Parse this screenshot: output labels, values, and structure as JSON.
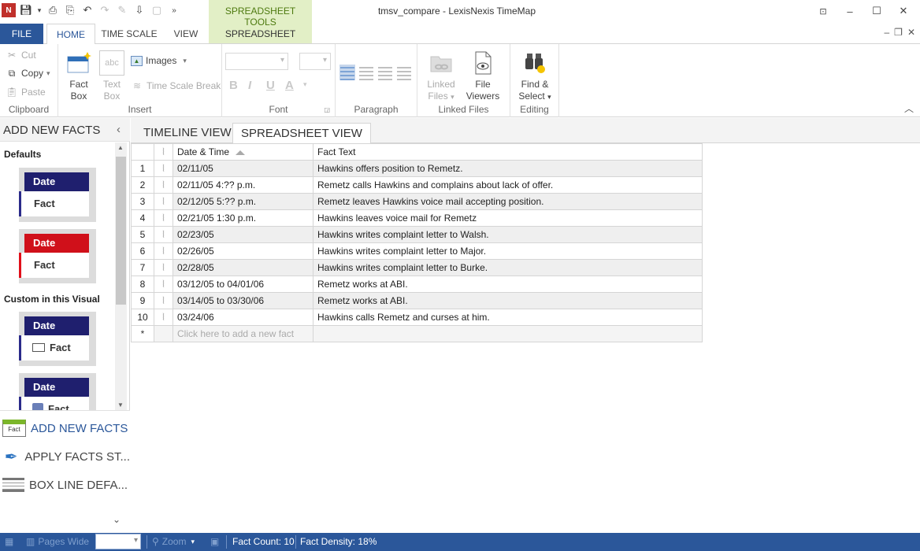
{
  "window": {
    "title": "tmsv_compare - LexisNexis TimeMap",
    "contextual_group": "SPREADSHEET TOOLS",
    "app_logo": "N"
  },
  "ribbon": {
    "tabs": {
      "file": "FILE",
      "home": "HOME",
      "time_scale": "TIME SCALE",
      "view": "VIEW",
      "spreadsheet": "SPREADSHEET"
    },
    "clipboard": {
      "label": "Clipboard",
      "cut": "Cut",
      "copy": "Copy",
      "paste": "Paste"
    },
    "insert": {
      "label": "Insert",
      "fact_box_line1": "Fact",
      "fact_box_line2": "Box",
      "text_box_line1": "Text",
      "text_box_line2": "Box",
      "text_box_icon_text": "abc",
      "images": "Images",
      "time_scale_break": "Time Scale Break"
    },
    "font": {
      "label": "Font",
      "bold": "B",
      "italic": "I",
      "underline": "U",
      "font_color": "A"
    },
    "paragraph": {
      "label": "Paragraph"
    },
    "linked_files": {
      "label": "Linked Files",
      "linked_files_line1": "Linked",
      "linked_files_line2": "Files",
      "file_viewers_line1": "File",
      "file_viewers_line2": "Viewers"
    },
    "editing": {
      "label": "Editing",
      "find_select_line1": "Find &",
      "find_select_line2": "Select"
    }
  },
  "left_pane": {
    "title": "ADD NEW FACTS",
    "defaults_label": "Defaults",
    "custom_label": "Custom in this Visual",
    "samples": [
      {
        "date": "Date",
        "fact": "Fact",
        "date_color": "#1f1f6e",
        "accent": "#2b2b8a"
      },
      {
        "date": "Date",
        "fact": "Fact",
        "date_color": "#d0101a",
        "accent": "#e0101a"
      },
      {
        "date": "Date",
        "fact": "Fact",
        "date_color": "#1f1f6e",
        "accent": "#2b2b8a"
      },
      {
        "date": "Date",
        "fact": "Fact",
        "date_color": "#1f1f6e",
        "accent": "#2b2b8a"
      }
    ],
    "nav": {
      "add_new_facts": "ADD NEW FACTS",
      "add_new_facts_icon_text": "Fact",
      "apply_facts": "APPLY FACTS ST...",
      "box_line": "BOX LINE DEFA..."
    }
  },
  "content": {
    "tabs": {
      "timeline": "TIMELINE VIEW",
      "spreadsheet": "SPREADSHEET VIEW"
    },
    "columns": {
      "date": "Date & Time",
      "fact": "Fact Text"
    },
    "rows": [
      {
        "n": "1",
        "date": "02/11/05",
        "fact": "Hawkins offers position to Remetz."
      },
      {
        "n": "2",
        "date": "02/11/05 4:?? p.m.",
        "fact": "Remetz calls Hawkins and complains about lack of offer."
      },
      {
        "n": "3",
        "date": "02/12/05 5:?? p.m.",
        "fact": "Remetz leaves Hawkins voice mail accepting position."
      },
      {
        "n": "4",
        "date": "02/21/05 1:30 p.m.",
        "fact": "Hawkins leaves voice mail for Remetz"
      },
      {
        "n": "5",
        "date": "02/23/05",
        "fact": "Hawkins writes complaint letter to Walsh."
      },
      {
        "n": "6",
        "date": "02/26/05",
        "fact": "Hawkins writes complaint letter to Major."
      },
      {
        "n": "7",
        "date": "02/28/05",
        "fact": "Hawkins writes complaint letter to Burke."
      },
      {
        "n": "8",
        "date": "03/12/05 to 04/01/06",
        "fact": "Remetz works at ABI."
      },
      {
        "n": "9",
        "date": "03/14/05 to 03/30/06",
        "fact": "Remetz works at ABI."
      },
      {
        "n": "10",
        "date": "03/24/06",
        "fact": "Hawkins calls Remetz and curses at him."
      }
    ],
    "new_row_marker": "*",
    "new_row_placeholder": "Click here to add a new fact"
  },
  "status": {
    "pages_wide": "Pages Wide",
    "zoom": "Zoom",
    "fact_count": "Fact Count: 10",
    "fact_density": "Fact Density: 18%"
  },
  "icons": {
    "attachment": "paperclip-icon",
    "cut": "scissors-icon",
    "copy": "copy-icon",
    "paste": "clipboard-icon"
  }
}
